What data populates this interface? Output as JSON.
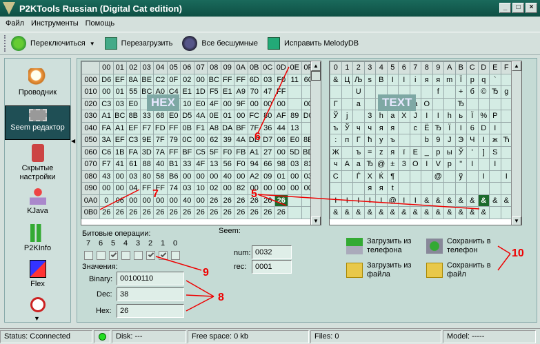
{
  "window": {
    "title": "P2KTools Russian (Digital Cat edition)",
    "minimize": "_",
    "maximize": "□",
    "close": "×"
  },
  "menu": [
    "Файл",
    "Инструменты",
    "Помощь"
  ],
  "toolbar": {
    "switch": "Переключиться",
    "reload": "Перезагрузить",
    "silent": "Все бесшумные",
    "fix": "Исправить MelodyDB"
  },
  "sidebar": [
    "Проводник",
    "Seem редактор",
    "Скрытые настройки",
    "KJava",
    "P2KInfo",
    "Flex"
  ],
  "hex": {
    "headers": [
      "00",
      "01",
      "02",
      "03",
      "04",
      "05",
      "06",
      "07",
      "08",
      "09",
      "0A",
      "0B",
      "0C",
      "0D",
      "0E",
      "0F"
    ],
    "rows": [
      {
        "addr": "000",
        "cells": [
          "D6",
          "EF",
          "8A",
          "BE",
          "C2",
          "0F",
          "02",
          "00",
          "BC",
          "FF",
          "FF",
          "6D",
          "03",
          "F0",
          "11",
          "60"
        ]
      },
      {
        "addr": "010",
        "cells": [
          "00",
          "01",
          "55",
          "BC",
          "A0",
          "C4",
          "E1",
          "1D",
          "F5",
          "E1",
          "A9",
          "70",
          "47",
          "FF",
          "",
          ""
        ]
      },
      {
        "addr": "020",
        "cells": [
          "C3",
          "03",
          "E0",
          "",
          "",
          "",
          "10",
          "E0",
          "4F",
          "00",
          "9F",
          "00",
          "00",
          "00",
          "",
          "00"
        ]
      },
      {
        "addr": "030",
        "cells": [
          "A1",
          "BC",
          "8B",
          "33",
          "68",
          "E0",
          "D5",
          "4A",
          "0E",
          "01",
          "00",
          "FC",
          "80",
          "AF",
          "89",
          "D0"
        ]
      },
      {
        "addr": "040",
        "cells": [
          "FA",
          "A1",
          "EF",
          "F7",
          "FD",
          "FF",
          "0B",
          "F1",
          "A8",
          "DA",
          "BF",
          "7F",
          "36",
          "44",
          "13",
          ""
        ]
      },
      {
        "addr": "050",
        "cells": [
          "3A",
          "EF",
          "C3",
          "9E",
          "7F",
          "79",
          "0C",
          "00",
          "62",
          "39",
          "4A",
          "DD",
          "D7",
          "06",
          "E0",
          "8E"
        ]
      },
      {
        "addr": "060",
        "cells": [
          "C6",
          "1B",
          "FA",
          "3D",
          "7A",
          "FF",
          "BF",
          "C5",
          "5F",
          "F0",
          "FB",
          "A1",
          "27",
          "00",
          "5D",
          "BD"
        ]
      },
      {
        "addr": "070",
        "cells": [
          "F7",
          "41",
          "61",
          "88",
          "40",
          "B1",
          "33",
          "4F",
          "13",
          "56",
          "F0",
          "94",
          "66",
          "98",
          "03",
          "81"
        ]
      },
      {
        "addr": "080",
        "cells": [
          "43",
          "00",
          "03",
          "80",
          "58",
          "B6",
          "00",
          "00",
          "00",
          "40",
          "00",
          "A2",
          "09",
          "01",
          "00",
          "03"
        ]
      },
      {
        "addr": "090",
        "cells": [
          "00",
          "00",
          "04",
          "FF",
          "FF",
          "74",
          "03",
          "10",
          "02",
          "00",
          "82",
          "00",
          "00",
          "00",
          "00",
          "00"
        ]
      },
      {
        "addr": "0A0",
        "cells": [
          "0",
          "06",
          "00",
          "00",
          "00",
          "00",
          "40",
          "00",
          "26",
          "26",
          "26",
          "26",
          "26",
          "26",
          "",
          ""
        ]
      },
      {
        "addr": "0B0",
        "cells": [
          "26",
          "26",
          "26",
          "26",
          "26",
          "26",
          "26",
          "26",
          "26",
          "26",
          "26",
          "26",
          "26",
          "26",
          "",
          ""
        ]
      }
    ]
  },
  "text": {
    "headers": [
      "0",
      "1",
      "2",
      "3",
      "4",
      "5",
      "6",
      "7",
      "8",
      "9",
      "A",
      "B",
      "C",
      "D",
      "E",
      "F"
    ],
    "rows": [
      [
        "&",
        "Ц",
        "Љ",
        "s",
        "В",
        "І",
        "І",
        "і",
        "я",
        "я",
        "m",
        "Ї",
        "р",
        "q",
        "`",
        ""
      ],
      [
        "",
        "",
        "U",
        "",
        "",
        "",
        "",
        "",
        "",
        "f",
        "",
        "+",
        "б",
        "©",
        "Ђ",
        "g"
      ],
      [
        "Г",
        "",
        "а",
        "",
        "",
        "",
        "",
        "а",
        "О",
        "",
        "",
        "Ђ",
        "",
        "",
        "",
        ""
      ],
      [
        "Ў",
        "ј",
        "",
        "3",
        "h",
        "а",
        "Х",
        "Ј",
        "І",
        "І",
        "h",
        "ь",
        "Ї",
        "%",
        "Р",
        ""
      ],
      [
        "ъ",
        "Ў",
        "ч",
        "ч",
        "я",
        "я",
        "",
        "с",
        "Ё",
        "Ђ",
        "Ї",
        "І",
        "6",
        "D",
        "І",
        ""
      ],
      [
        ":",
        "п",
        "Г",
        "ћ",
        "у",
        "ъ",
        "",
        "",
        "b",
        "9",
        "J",
        "Э",
        "Ч",
        "І",
        "ж",
        "Ћ"
      ],
      [
        "Ж",
        "",
        "ъ",
        "=",
        "z",
        "я",
        "ї",
        "Е",
        "_",
        "р",
        "ы",
        "Ў",
        "'",
        "]",
        "S",
        ""
      ],
      [
        "ч",
        "А",
        "а",
        "Ђ",
        "@",
        "±",
        "3",
        "O",
        "І",
        "V",
        "р",
        "\"",
        "І",
        "",
        "І",
        ""
      ],
      [
        "С",
        "",
        "Ѓ",
        "X",
        "Ќ",
        "¶",
        "",
        "",
        "",
        "@",
        "",
        "ў",
        "",
        "І",
        "",
        "І"
      ],
      [
        "",
        "",
        "",
        "я",
        "я",
        "t",
        "",
        "",
        "",
        "",
        "",
        "",
        "",
        "",
        "",
        ""
      ],
      [
        "І",
        "І",
        "І",
        "І",
        "І",
        "@",
        "І",
        "І",
        "&",
        "&",
        "&",
        "&",
        "&",
        "&",
        "&",
        "&"
      ],
      [
        "&",
        "&",
        "&",
        "&",
        "&",
        "&",
        "&",
        "&",
        "&",
        "&",
        "&",
        "&",
        "&",
        "&",
        "",
        ""
      ]
    ]
  },
  "labels": {
    "hex_overlay": "HEX",
    "text_overlay": "TEXT",
    "bit_ops": "Битовые операции:",
    "seem": "Seem:",
    "values": "Значения:",
    "binary": "Binary:",
    "dec": "Dec:",
    "hex": "Hex:",
    "num": "num:",
    "rec": "rec:"
  },
  "bits": [
    "7",
    "6",
    "5",
    "4",
    "3",
    "2",
    "1",
    "0"
  ],
  "bits_checked": [
    false,
    false,
    true,
    false,
    false,
    true,
    true,
    false
  ],
  "values": {
    "binary": "00100110",
    "dec": "38",
    "hex": "26",
    "num": "0032",
    "rec": "0001"
  },
  "actions": {
    "load_phone": "Загрузить из телефона",
    "load_file": "Загрузить из файла",
    "save_phone": "Сохранить в телефон",
    "save_file": "Сохранить в файл"
  },
  "annotations": [
    "5",
    "6",
    "7",
    "8",
    "9",
    "10"
  ],
  "status": {
    "conn": "Status: Cconnected",
    "disk": "Disk: ---",
    "free": "Free space: 0 kb",
    "files": "Files: 0",
    "model": "Model: -----"
  }
}
